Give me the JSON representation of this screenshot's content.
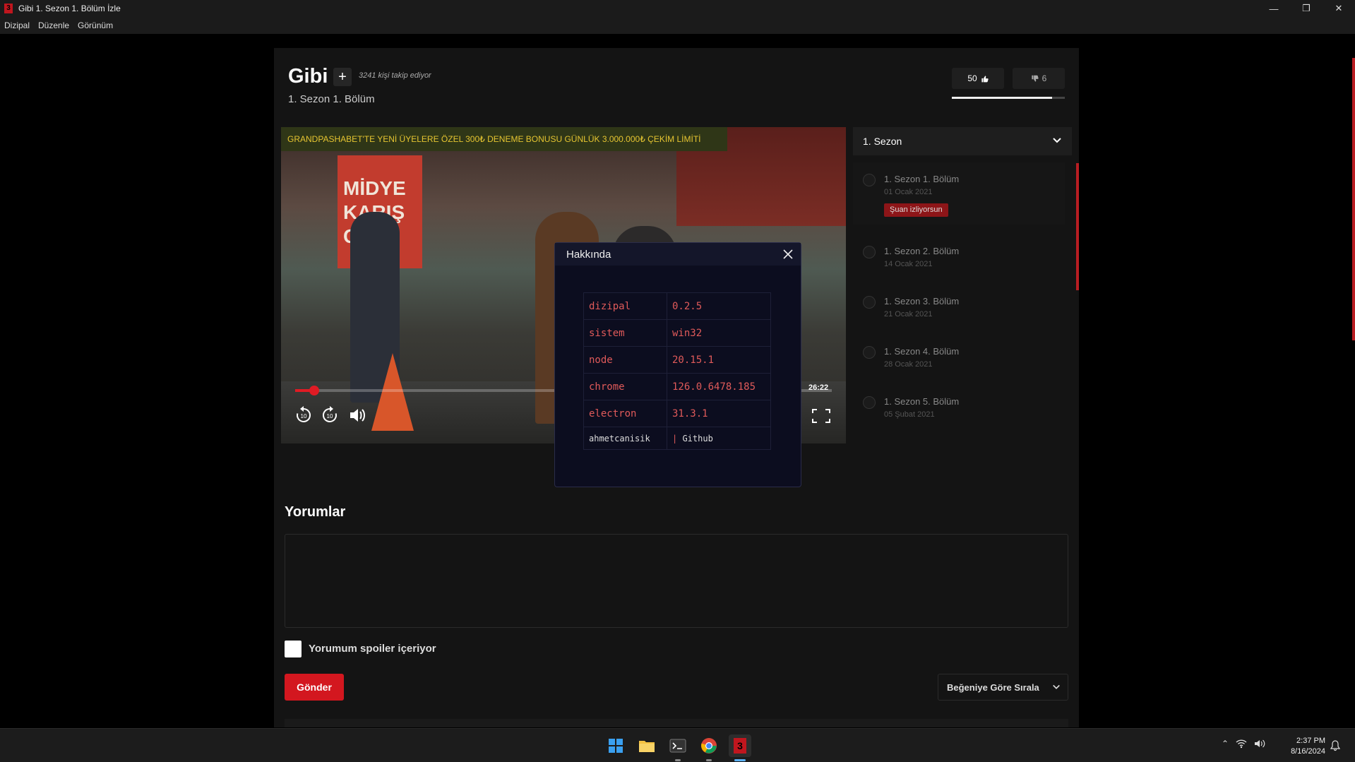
{
  "window": {
    "title": "Gibi 1. Sezon 1. Bölüm İzle",
    "app_logo_letter": "3",
    "controls": [
      "—",
      "❐",
      "✕"
    ]
  },
  "menu": [
    "Dizipal",
    "Düzenle",
    "Görünüm"
  ],
  "show": {
    "title": "Gibi",
    "follow_label": "+",
    "followers": "3241 kişi takip ediyor",
    "episode": "1. Sezon 1. Bölüm",
    "likes": "50",
    "dislikes": "6",
    "like_ratio": 0.89
  },
  "player": {
    "ad_text": "GRANDPASHABET'TE YENİ ÜYELERE ÖZEL 300₺ DENEME BONUSU GÜNLÜK 3.000.000₺ ÇEKİM LİMİTİ",
    "scene_sign": "MİDYE\nKARIŞ\nCUK",
    "time": "26:22",
    "progress": 0.03,
    "rewind_label": "10",
    "forward_label": "10"
  },
  "season": {
    "selected": "1. Sezon",
    "episodes": [
      {
        "title": "1. Sezon 1. Bölüm",
        "date": "01 Ocak 2021",
        "badge": "Şuan izliyorsun"
      },
      {
        "title": "1. Sezon 2. Bölüm",
        "date": "14 Ocak 2021"
      },
      {
        "title": "1. Sezon 3. Bölüm",
        "date": "21 Ocak 2021"
      },
      {
        "title": "1. Sezon 4. Bölüm",
        "date": "28 Ocak 2021"
      },
      {
        "title": "1. Sezon 5. Bölüm",
        "date": "05 Şubat 2021"
      }
    ]
  },
  "about": {
    "title": "Hakkında",
    "rows": [
      {
        "key": "dizipal",
        "value": "0.2.5"
      },
      {
        "key": "sistem",
        "value": "win32"
      },
      {
        "key": "node",
        "value": "20.15.1"
      },
      {
        "key": "chrome",
        "value": "126.0.6478.185"
      },
      {
        "key": "electron",
        "value": "31.3.1"
      }
    ],
    "author": "ahmetcanisik",
    "github_label": "Github"
  },
  "comments": {
    "title": "Yorumlar",
    "spoiler_label": "Yorumum spoiler içeriyor",
    "send_label": "Gönder",
    "sort_label": "Beğeniye Göre Sırala"
  },
  "taskbar": {
    "time": "2:37 PM",
    "date": "8/16/2024"
  },
  "colors": {
    "accent": "#d3171f",
    "ad_text": "#e6c531",
    "modal_value": "#e05a5a"
  }
}
